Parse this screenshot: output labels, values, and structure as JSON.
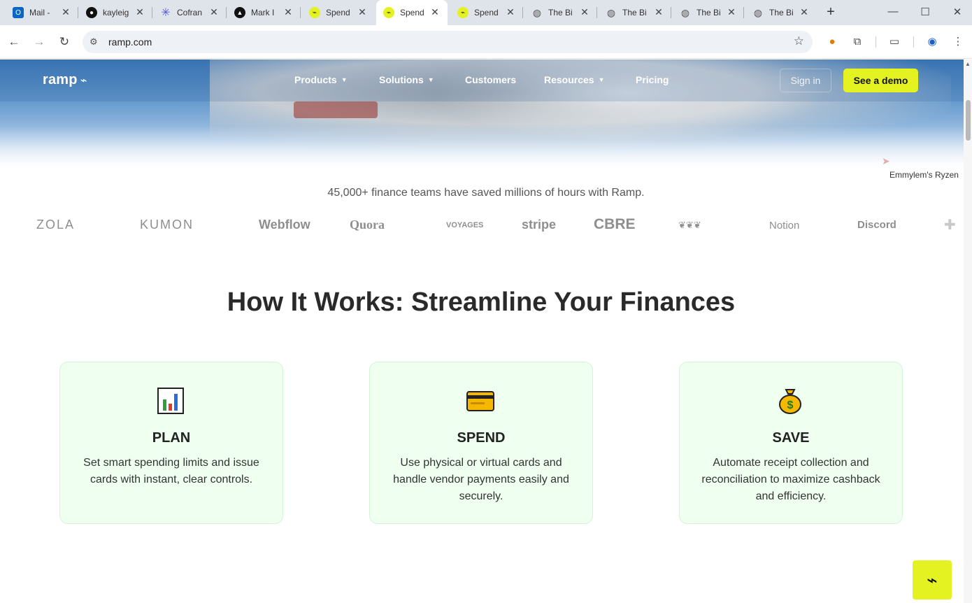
{
  "browser": {
    "tabs": [
      {
        "label": "Mail -",
        "icon": "outlook-icon",
        "color": "#0a66c2"
      },
      {
        "label": "kayleig",
        "icon": "github-icon",
        "color": "#111111"
      },
      {
        "label": "Cofran",
        "icon": "asterisk-icon",
        "color": "#5b5bd6"
      },
      {
        "label": "Mark I",
        "icon": "triangle-logo-icon",
        "color": "#111111"
      },
      {
        "label": "Spend",
        "icon": "ramp-icon",
        "color": "#e4f221"
      },
      {
        "label": "Spend",
        "icon": "ramp-icon",
        "color": "#e4f221",
        "active": true
      },
      {
        "label": "Spend",
        "icon": "ramp-icon",
        "color": "#e4f221"
      },
      {
        "label": "The Bi",
        "icon": "globe-icon",
        "color": "#555555"
      },
      {
        "label": "The Bi",
        "icon": "globe-icon",
        "color": "#555555"
      },
      {
        "label": "The Bi",
        "icon": "globe-icon",
        "color": "#555555"
      },
      {
        "label": "The Bi",
        "icon": "globe-icon",
        "color": "#555555"
      }
    ],
    "url": "ramp.com"
  },
  "nav": {
    "logo": "ramp",
    "links": [
      {
        "label": "Products",
        "has_menu": true
      },
      {
        "label": "Solutions",
        "has_menu": true
      },
      {
        "label": "Customers",
        "has_menu": false
      },
      {
        "label": "Resources",
        "has_menu": true
      },
      {
        "label": "Pricing",
        "has_menu": false
      }
    ],
    "sign_in": "Sign in",
    "cta": "See a demo"
  },
  "tooltip": "Emmylem's Ryzen",
  "tagline": "45,000+ finance teams have saved millions of hours with Ramp.",
  "logos": [
    "ZOLA",
    "KUMON",
    "Webflow",
    "Quora",
    "VOYAGES",
    "stripe",
    "CBRE",
    "Notion",
    "Discord"
  ],
  "section": {
    "heading": "How It Works: Streamline Your Finances",
    "cards": [
      {
        "icon": "bar-chart-icon",
        "title": "PLAN",
        "description": "Set smart spending limits and issue cards with instant, clear controls."
      },
      {
        "icon": "credit-card-icon",
        "title": "SPEND",
        "description": "Use physical or virtual cards and handle vendor payments easily and securely."
      },
      {
        "icon": "money-bag-icon",
        "title": "SAVE",
        "description": "Automate receipt collection and reconciliation to maximize cashback and efficiency."
      }
    ]
  },
  "colors": {
    "accent": "#e4f221",
    "card_bg": "#effff0",
    "card_border": "#d2f5d6"
  }
}
